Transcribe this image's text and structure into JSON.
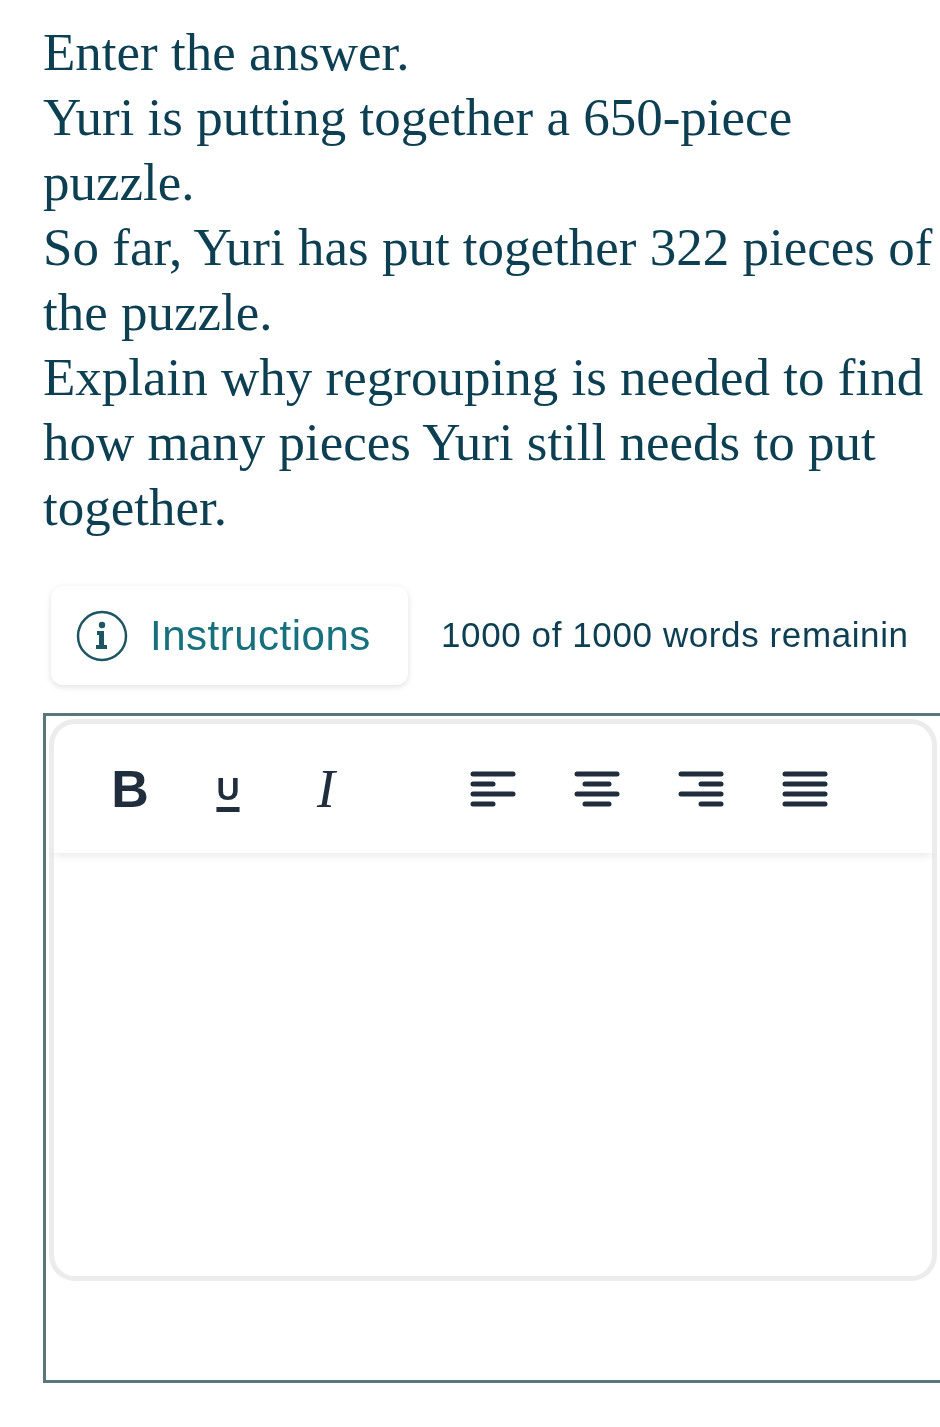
{
  "prompt": {
    "heading": "Enter the answer.",
    "paragraphs": [
      "Yuri is putting together a 650-piece puzzle.",
      "So far, Yuri has put together 322 pieces of the puzzle.",
      "Explain why regrouping is needed to find how many pieces Yuri still needs to put together."
    ]
  },
  "instructions_button": {
    "label": "Instructions"
  },
  "word_count": "1000 of 1000 words remainin",
  "editor": {
    "toolbar": [
      {
        "kind": "bold",
        "label": "B"
      },
      {
        "kind": "underline",
        "label": "U"
      },
      {
        "kind": "italic",
        "label": "I"
      },
      {
        "kind": "align-left"
      },
      {
        "kind": "align-center"
      },
      {
        "kind": "align-right"
      },
      {
        "kind": "justify"
      }
    ]
  }
}
